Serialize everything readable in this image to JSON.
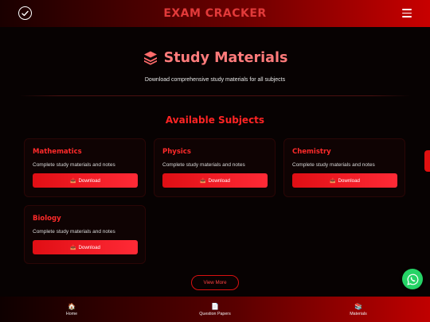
{
  "header": {
    "brand": "EXAM CRACKER",
    "logo_icon": "check-circle-icon",
    "menu_icon": "hamburger-menu-icon"
  },
  "hero": {
    "icon": "layers-icon",
    "title": "Study Materials",
    "subtitle": "Download comprehensive study materials for all subjects"
  },
  "section": {
    "title": "Available Subjects"
  },
  "subjects": [
    {
      "name": "Mathematics",
      "description": "Complete study materials and notes",
      "button_icon": "📥",
      "button_label": "Download"
    },
    {
      "name": "Physics",
      "description": "Complete study materials and notes",
      "button_icon": "📥",
      "button_label": "Download"
    },
    {
      "name": "Chemistry",
      "description": "Complete study materials and notes",
      "button_icon": "📥",
      "button_label": "Download"
    },
    {
      "name": "Biology",
      "description": "Complete study materials and notes",
      "button_icon": "📥",
      "button_label": "Download"
    }
  ],
  "view_more": "View More",
  "bottom_nav": [
    {
      "icon": "🏠",
      "label": "Home"
    },
    {
      "icon": "📄",
      "label": "Question Papers"
    },
    {
      "icon": "📚",
      "label": "Materials"
    }
  ],
  "colors": {
    "accent": "#ff2a2a",
    "hero_title": "#ff7b7b",
    "whatsapp": "#25d366"
  }
}
